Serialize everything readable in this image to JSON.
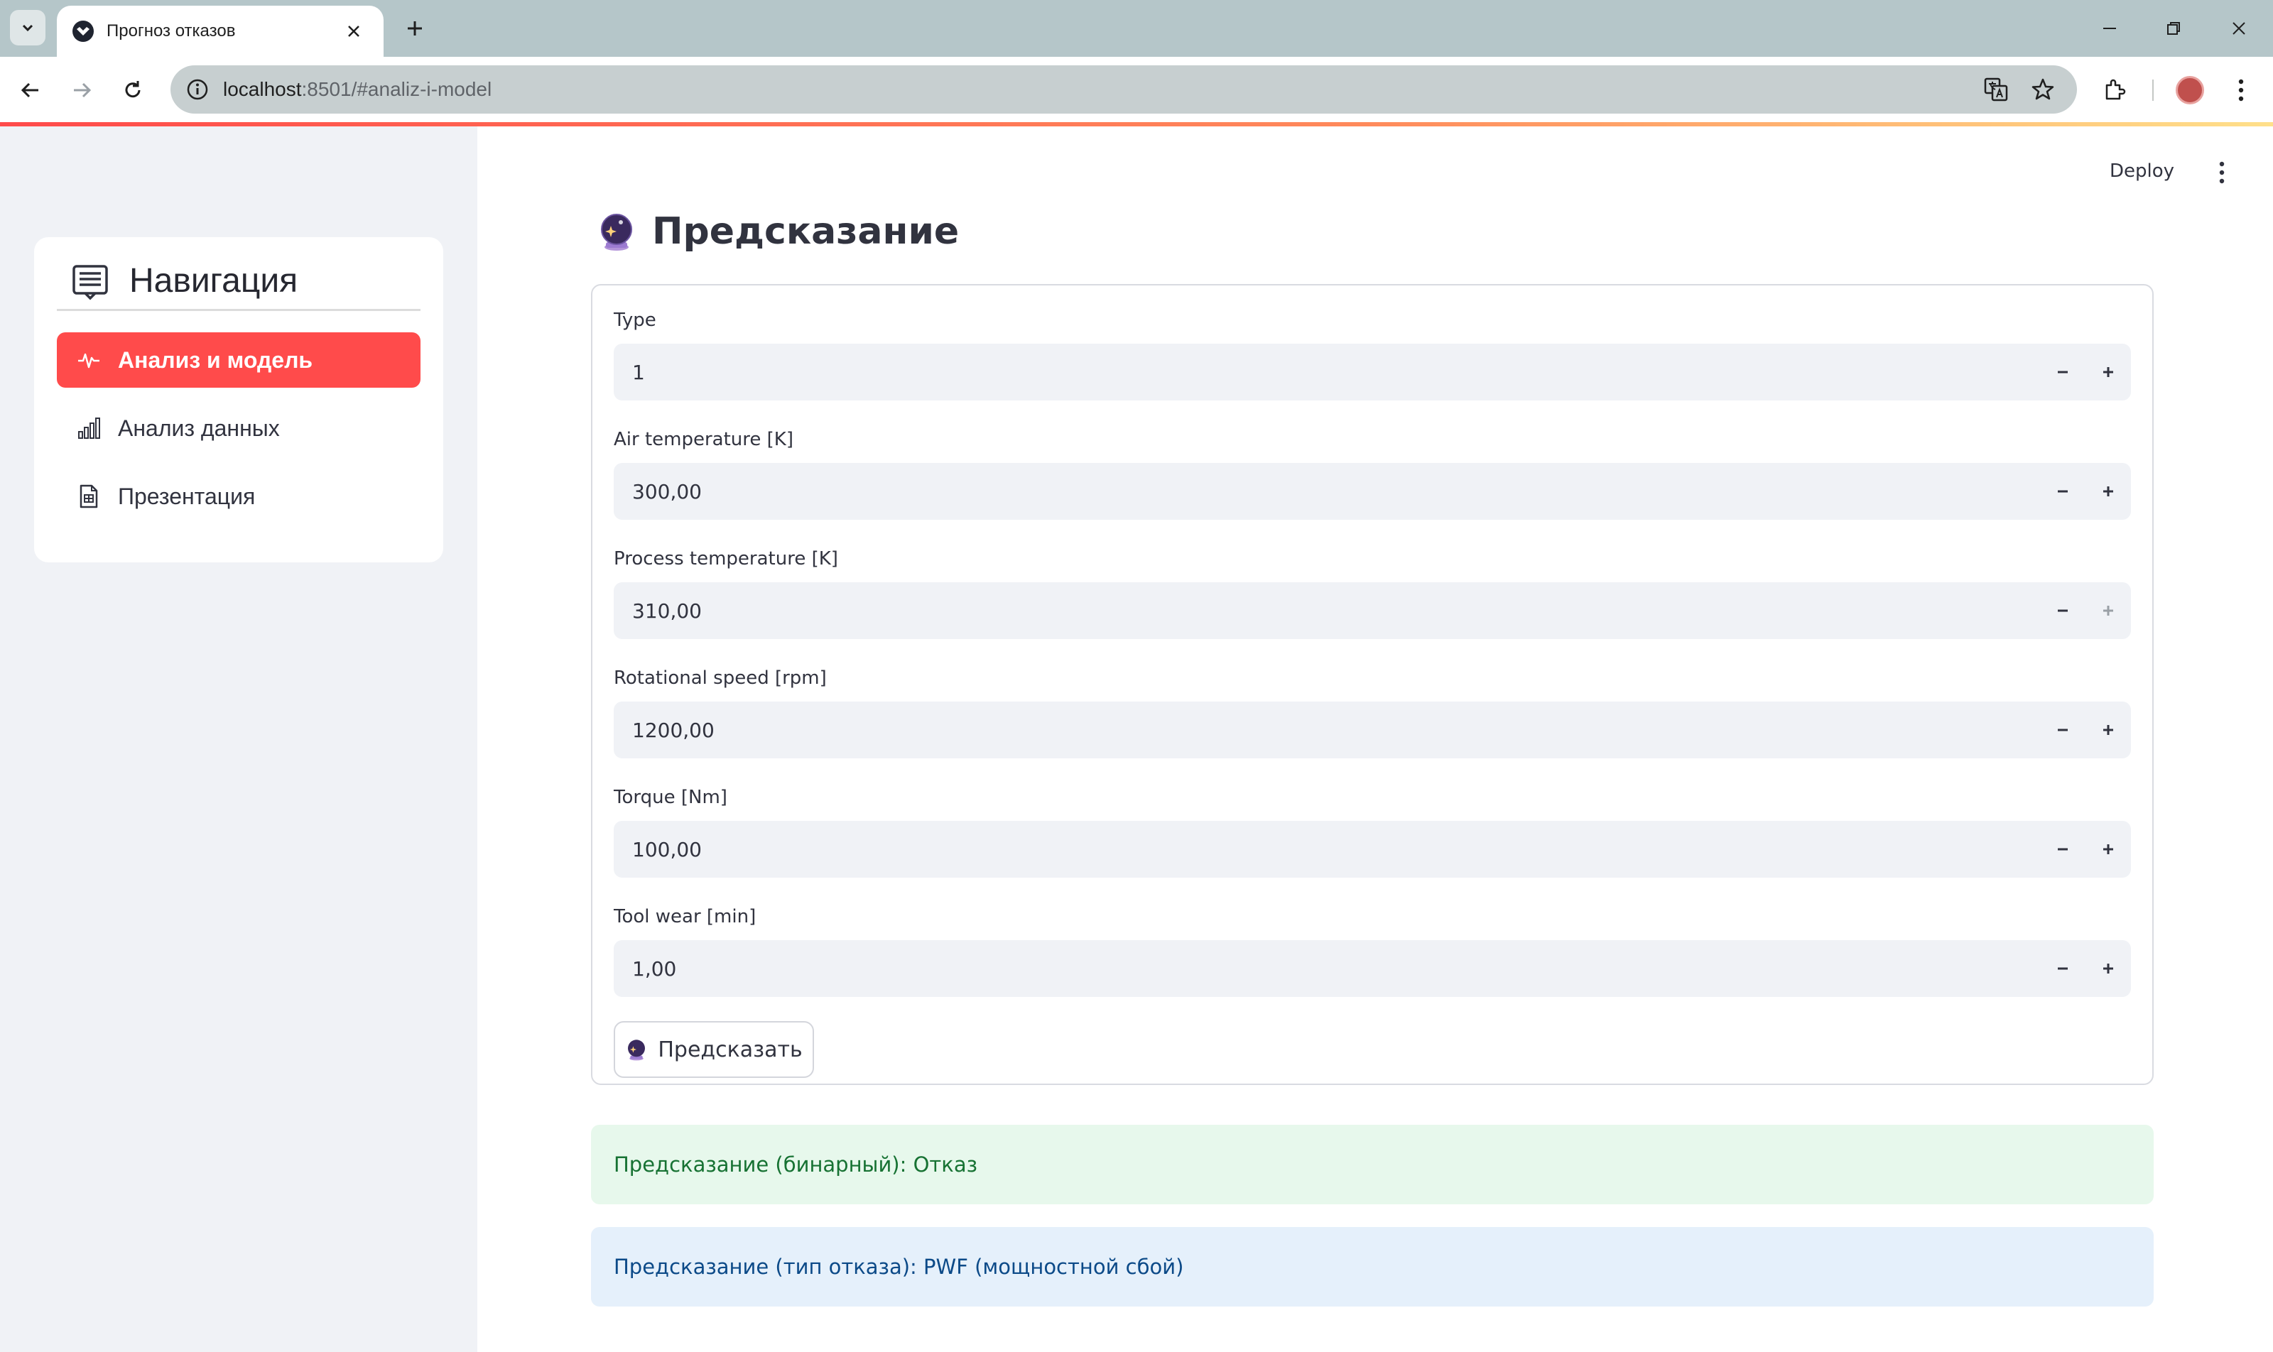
{
  "browser": {
    "tab_title": "Прогноз отказов",
    "url_host": "localhost",
    "url_rest": ":8501/#analiz-i-model"
  },
  "app": {
    "deploy_label": "Deploy",
    "sidebar": {
      "title": "Навигация",
      "items": [
        {
          "label": "Анализ и модель",
          "icon": "activity-icon",
          "active": true
        },
        {
          "label": "Анализ данных",
          "icon": "bar-chart-icon",
          "active": false
        },
        {
          "label": "Презентация",
          "icon": "file-slides-icon",
          "active": false
        }
      ]
    },
    "main": {
      "title": "Предсказание",
      "fields": [
        {
          "label": "Type",
          "value": "1"
        },
        {
          "label": "Air temperature [K]",
          "value": "300,00"
        },
        {
          "label": "Process temperature [K]",
          "value": "310,00"
        },
        {
          "label": "Rotational speed [rpm]",
          "value": "1200,00"
        },
        {
          "label": "Torque [Nm]",
          "value": "100,00"
        },
        {
          "label": "Tool wear [min]",
          "value": "1,00"
        }
      ],
      "predict_button": "Предсказать",
      "result_binary": "Предсказание (бинарный): Отказ",
      "result_type": "Предсказание (тип отказа): PWF (мощностной сбой)"
    }
  },
  "colors": {
    "primary": "#ff4b4b",
    "sidebar_bg": "#f0f2f6",
    "success_bg": "#e7f8ec",
    "success_text": "#177233",
    "info_bg": "#e5f0fb",
    "info_text": "#0c4a88"
  }
}
